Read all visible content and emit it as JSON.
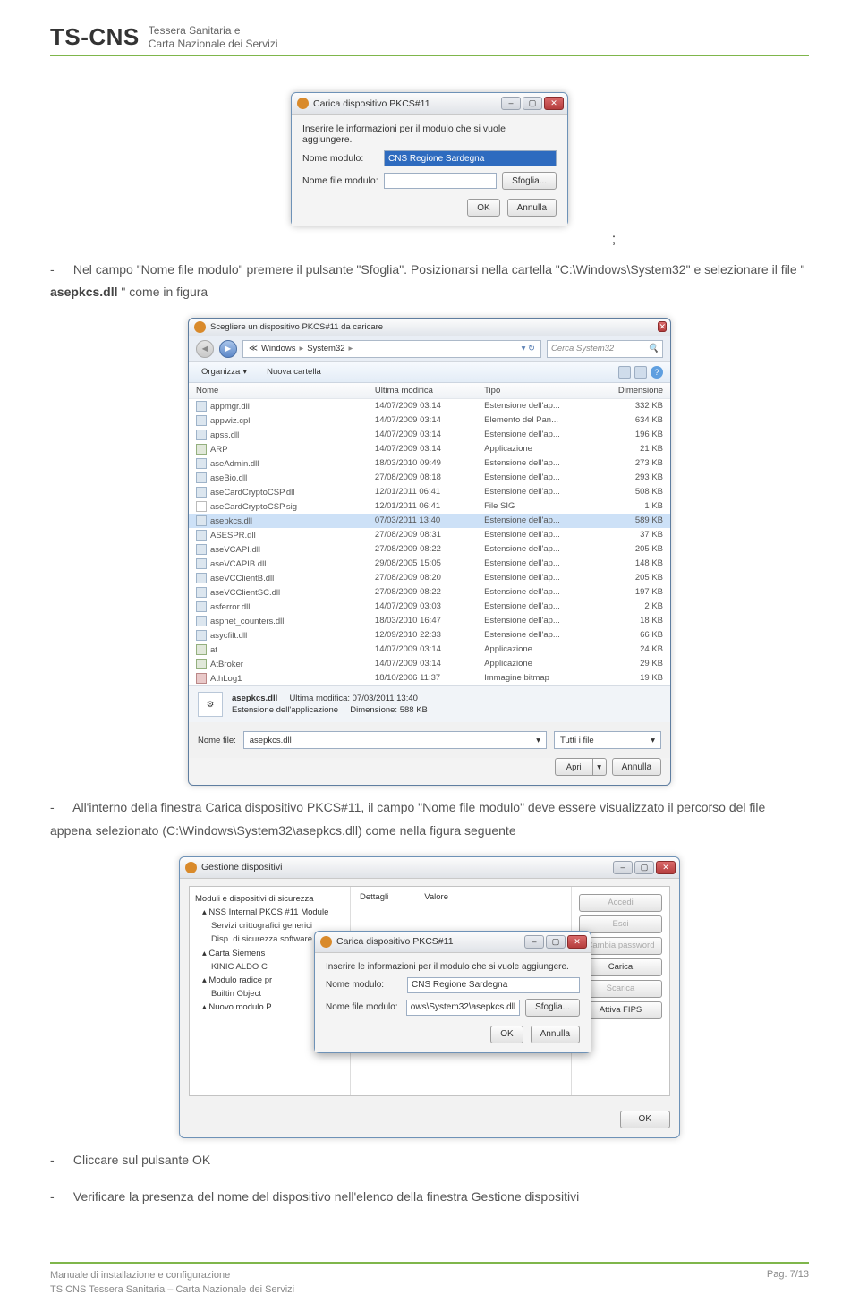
{
  "header": {
    "logo_line": "TS-CNS",
    "sub1": "Tessera Sanitaria e",
    "sub2": "Carta Nazionale dei Servizi"
  },
  "dialog1": {
    "title": "Carica dispositivo PKCS#11",
    "instruction": "Inserire le informazioni per il modulo che si vuole aggiungere.",
    "label_name": "Nome modulo:",
    "value_name": "CNS Regione Sardegna",
    "label_file": "Nome file modulo:",
    "value_file": "",
    "btn_browse": "Sfoglia...",
    "btn_ok": "OK",
    "btn_cancel": "Annulla"
  },
  "semicolon": ";",
  "step1_a": "Nel campo \"Nome file modulo\" premere il pulsante \"Sfoglia\". Posizionarsi nella cartella \"C:\\Windows\\System32\" e selezionare il file \"",
  "step1_b": "asepkcs.dll",
  "step1_c": "\" come in figura",
  "filedlg": {
    "title": "Scegliere un dispositivo PKCS#11 da caricare",
    "addr_p1": "Windows",
    "addr_p2": "System32",
    "search_ph": "Cerca System32",
    "organize": "Organizza",
    "newfolder": "Nuova cartella",
    "columns": {
      "name": "Nome",
      "date": "Ultima modifica",
      "type": "Tipo",
      "size": "Dimensione"
    },
    "rows": [
      {
        "icon": "gear",
        "name": "appmgr.dll",
        "date": "14/07/2009 03:14",
        "type": "Estensione dell'ap...",
        "size": "332 KB"
      },
      {
        "icon": "gear",
        "name": "appwiz.cpl",
        "date": "14/07/2009 03:14",
        "type": "Elemento del Pan...",
        "size": "634 KB"
      },
      {
        "icon": "gear",
        "name": "apss.dll",
        "date": "14/07/2009 03:14",
        "type": "Estensione dell'ap...",
        "size": "196 KB"
      },
      {
        "icon": "app",
        "name": "ARP",
        "date": "14/07/2009 03:14",
        "type": "Applicazione",
        "size": "21 KB"
      },
      {
        "icon": "gear",
        "name": "aseAdmin.dll",
        "date": "18/03/2010 09:49",
        "type": "Estensione dell'ap...",
        "size": "273 KB"
      },
      {
        "icon": "gear",
        "name": "aseBio.dll",
        "date": "27/08/2009 08:18",
        "type": "Estensione dell'ap...",
        "size": "293 KB"
      },
      {
        "icon": "gear",
        "name": "aseCardCryptoCSP.dll",
        "date": "12/01/2011 06:41",
        "type": "Estensione dell'ap...",
        "size": "508 KB"
      },
      {
        "icon": "txt",
        "name": "aseCardCryptoCSP.sig",
        "date": "12/01/2011 06:41",
        "type": "File SIG",
        "size": "1 KB"
      },
      {
        "icon": "gear",
        "name": "asepkcs.dll",
        "date": "07/03/2011 13:40",
        "type": "Estensione dell'ap...",
        "size": "589 KB",
        "sel": true
      },
      {
        "icon": "gear",
        "name": "ASESPR.dll",
        "date": "27/08/2009 08:31",
        "type": "Estensione dell'ap...",
        "size": "37 KB"
      },
      {
        "icon": "gear",
        "name": "aseVCAPI.dll",
        "date": "27/08/2009 08:22",
        "type": "Estensione dell'ap...",
        "size": "205 KB"
      },
      {
        "icon": "gear",
        "name": "aseVCAPIB.dll",
        "date": "29/08/2005 15:05",
        "type": "Estensione dell'ap...",
        "size": "148 KB"
      },
      {
        "icon": "gear",
        "name": "aseVCClientB.dll",
        "date": "27/08/2009 08:20",
        "type": "Estensione dell'ap...",
        "size": "205 KB"
      },
      {
        "icon": "gear",
        "name": "aseVCClientSC.dll",
        "date": "27/08/2009 08:22",
        "type": "Estensione dell'ap...",
        "size": "197 KB"
      },
      {
        "icon": "gear",
        "name": "asferror.dll",
        "date": "14/07/2009 03:03",
        "type": "Estensione dell'ap...",
        "size": "2 KB"
      },
      {
        "icon": "gear",
        "name": "aspnet_counters.dll",
        "date": "18/03/2010 16:47",
        "type": "Estensione dell'ap...",
        "size": "18 KB"
      },
      {
        "icon": "gear",
        "name": "asycfilt.dll",
        "date": "12/09/2010 22:33",
        "type": "Estensione dell'ap...",
        "size": "66 KB"
      },
      {
        "icon": "app",
        "name": "at",
        "date": "14/07/2009 03:14",
        "type": "Applicazione",
        "size": "24 KB"
      },
      {
        "icon": "app",
        "name": "AtBroker",
        "date": "14/07/2009 03:14",
        "type": "Applicazione",
        "size": "29 KB"
      },
      {
        "icon": "bmp",
        "name": "AthLog1",
        "date": "18/10/2006 11:37",
        "type": "Immagine bitmap",
        "size": "19 KB"
      }
    ],
    "preview_name": "asepkcs.dll",
    "preview_type": "Estensione dell'applicazione",
    "preview_mod_lbl": "Ultima modifica:",
    "preview_mod": "07/03/2011 13:40",
    "preview_size_lbl": "Dimensione:",
    "preview_size": "588 KB",
    "filelabel": "Nome file:",
    "filename": "asepkcs.dll",
    "filter": "Tutti i file",
    "btn_open": "Apri",
    "btn_cancel": "Annulla"
  },
  "step2_a": "All'interno della finestra Carica dispositivo PKCS#11, il campo \"Nome file modulo\" deve essere visualizzato il percorso del file appena selezionato (C:\\Windows\\System32\\asepkcs.dll) come nella figura seguente",
  "gd": {
    "title": "Gestione dispositivi",
    "tree_hdr": "Moduli e dispositivi di sicurezza",
    "tree": [
      {
        "t": "node",
        "label": "NSS Internal PKCS #11 Module"
      },
      {
        "t": "leaf",
        "label": "Servizi crittografici generici"
      },
      {
        "t": "leaf",
        "label": "Disp. di sicurezza software"
      },
      {
        "t": "node",
        "label": "Carta Siemens"
      },
      {
        "t": "leaf",
        "label": "KINIC ALDO C"
      },
      {
        "t": "node",
        "label": "Modulo radice pr"
      },
      {
        "t": "leaf",
        "label": "Builtin Object"
      },
      {
        "t": "node",
        "label": "Nuovo modulo P"
      }
    ],
    "col1": "Dettagli",
    "col2": "Valore",
    "btns": {
      "login": "Accedi",
      "logout": "Esci",
      "chpw": "Cambia password",
      "load": "Carica",
      "unload": "Scarica",
      "fips": "Attiva FIPS",
      "ok": "OK"
    }
  },
  "overlay": {
    "title": "Carica dispositivo PKCS#11",
    "instruction": "Inserire le informazioni per il modulo che si vuole aggiungere.",
    "label_name": "Nome modulo:",
    "value_name": "CNS Regione Sardegna",
    "label_file": "Nome file modulo:",
    "value_file": "ows\\System32\\asepkcs.dll",
    "btn_browse": "Sfoglia...",
    "btn_ok": "OK",
    "btn_cancel": "Annulla"
  },
  "step3": "Cliccare sul pulsante OK",
  "step4": "Verificare la presenza del nome del dispositivo nell'elenco della finestra Gestione dispositivi",
  "footer": {
    "line1": "Manuale di installazione e configurazione",
    "line2": "TS CNS Tessera Sanitaria – Carta Nazionale dei Servizi",
    "page": "Pag. 7/13"
  }
}
